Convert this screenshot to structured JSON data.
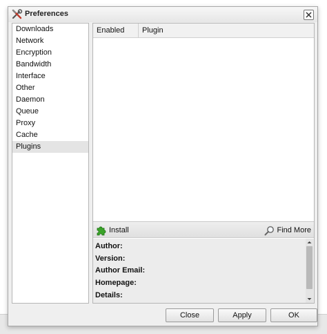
{
  "window": {
    "title": "Preferences",
    "title_icon": "tools-icon",
    "close_icon": "close-icon"
  },
  "sidebar": {
    "items": [
      {
        "label": "Downloads",
        "selected": false
      },
      {
        "label": "Network",
        "selected": false
      },
      {
        "label": "Encryption",
        "selected": false
      },
      {
        "label": "Bandwidth",
        "selected": false
      },
      {
        "label": "Interface",
        "selected": false
      },
      {
        "label": "Other",
        "selected": false
      },
      {
        "label": "Daemon",
        "selected": false
      },
      {
        "label": "Queue",
        "selected": false
      },
      {
        "label": "Proxy",
        "selected": false
      },
      {
        "label": "Cache",
        "selected": false
      },
      {
        "label": "Plugins",
        "selected": true
      }
    ]
  },
  "plugins_table": {
    "columns": [
      "Enabled",
      "Plugin"
    ],
    "rows": []
  },
  "toolbar": {
    "install_label": "Install",
    "install_icon": "puzzle-piece-icon",
    "find_more_label": "Find More",
    "find_more_icon": "magnifier-icon"
  },
  "details": {
    "author_label": "Author:",
    "version_label": "Version:",
    "author_email_label": "Author Email:",
    "homepage_label": "Homepage:",
    "details_label": "Details:"
  },
  "buttons": {
    "close_label": "Close",
    "apply_label": "Apply",
    "ok_label": "OK"
  },
  "colors": {
    "selected_item_bg": "#e4e4e4",
    "dialog_bg": "#efefef",
    "install_icon_green": "#3aa329"
  }
}
